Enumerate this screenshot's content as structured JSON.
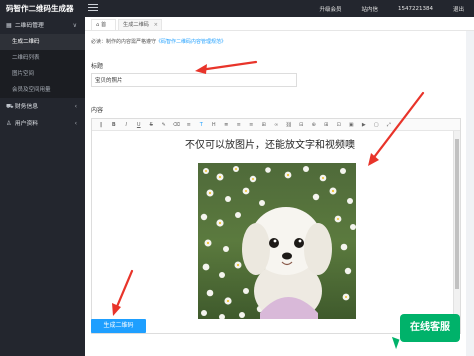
{
  "app": {
    "brand": "码智作二维码生成器"
  },
  "topbar": {
    "items": [
      "升级会员",
      "站内信",
      "1547221384",
      "退出"
    ]
  },
  "sidebar": {
    "groups": [
      {
        "label": "二维码管理",
        "icon": "grid-icon",
        "chev": "∨"
      },
      {
        "label": "财务信息",
        "icon": "cart-icon",
        "chev": "‹"
      },
      {
        "label": "用户资料",
        "icon": "user-icon",
        "chev": "‹"
      }
    ],
    "subs": [
      "生成二维码",
      "二维码列表",
      "图片空间",
      "会员及空间用量"
    ]
  },
  "tabs": {
    "home": "首页",
    "current": "生成二维码"
  },
  "form": {
    "notice_text": "必读：制作的内容需严格遵守",
    "notice_link": "《码智作二维码内容管理规范》",
    "title_label": "标题",
    "title_value": "宝贝的照片",
    "content_label": "内容",
    "editor_text": "不仅可以放图片，还能放文字和视频噢",
    "submit": "生成二维码"
  },
  "toolbar": [
    "‖",
    "B",
    "I",
    "U",
    "S",
    "✎",
    "⌫",
    "≡",
    "T",
    "H",
    "≣",
    "≡",
    "≡",
    "⊞",
    "∞",
    "⛓",
    "⊟",
    "⊕",
    "⊞",
    "⊡",
    "▣",
    "▶",
    "▢",
    "⤢"
  ],
  "kefu": "在线客服",
  "colors": {
    "sidebar": "#23262e",
    "accent": "#1e9fff",
    "kefu": "#00b26a",
    "arrow": "#e8342a"
  }
}
